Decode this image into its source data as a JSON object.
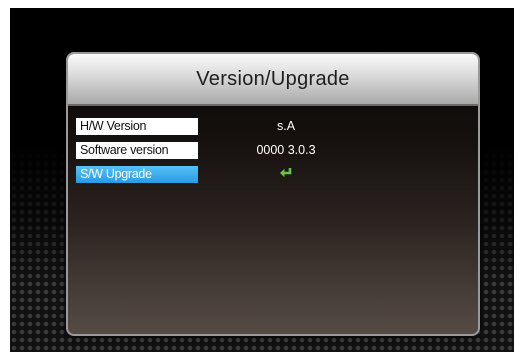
{
  "dialog": {
    "title": "Version/Upgrade"
  },
  "rows": [
    {
      "label": "H/W Version",
      "value": "s.A",
      "selected": false
    },
    {
      "label": "Software version",
      "value": "0000 3.0.3",
      "selected": false
    },
    {
      "label": "S/W Upgrade",
      "value_icon": "enter-arrow-icon",
      "selected": true
    }
  ],
  "colors": {
    "highlight": "#2a9ae6",
    "enter_icon": "#6cc24a",
    "label_bg": "#ffffff"
  }
}
